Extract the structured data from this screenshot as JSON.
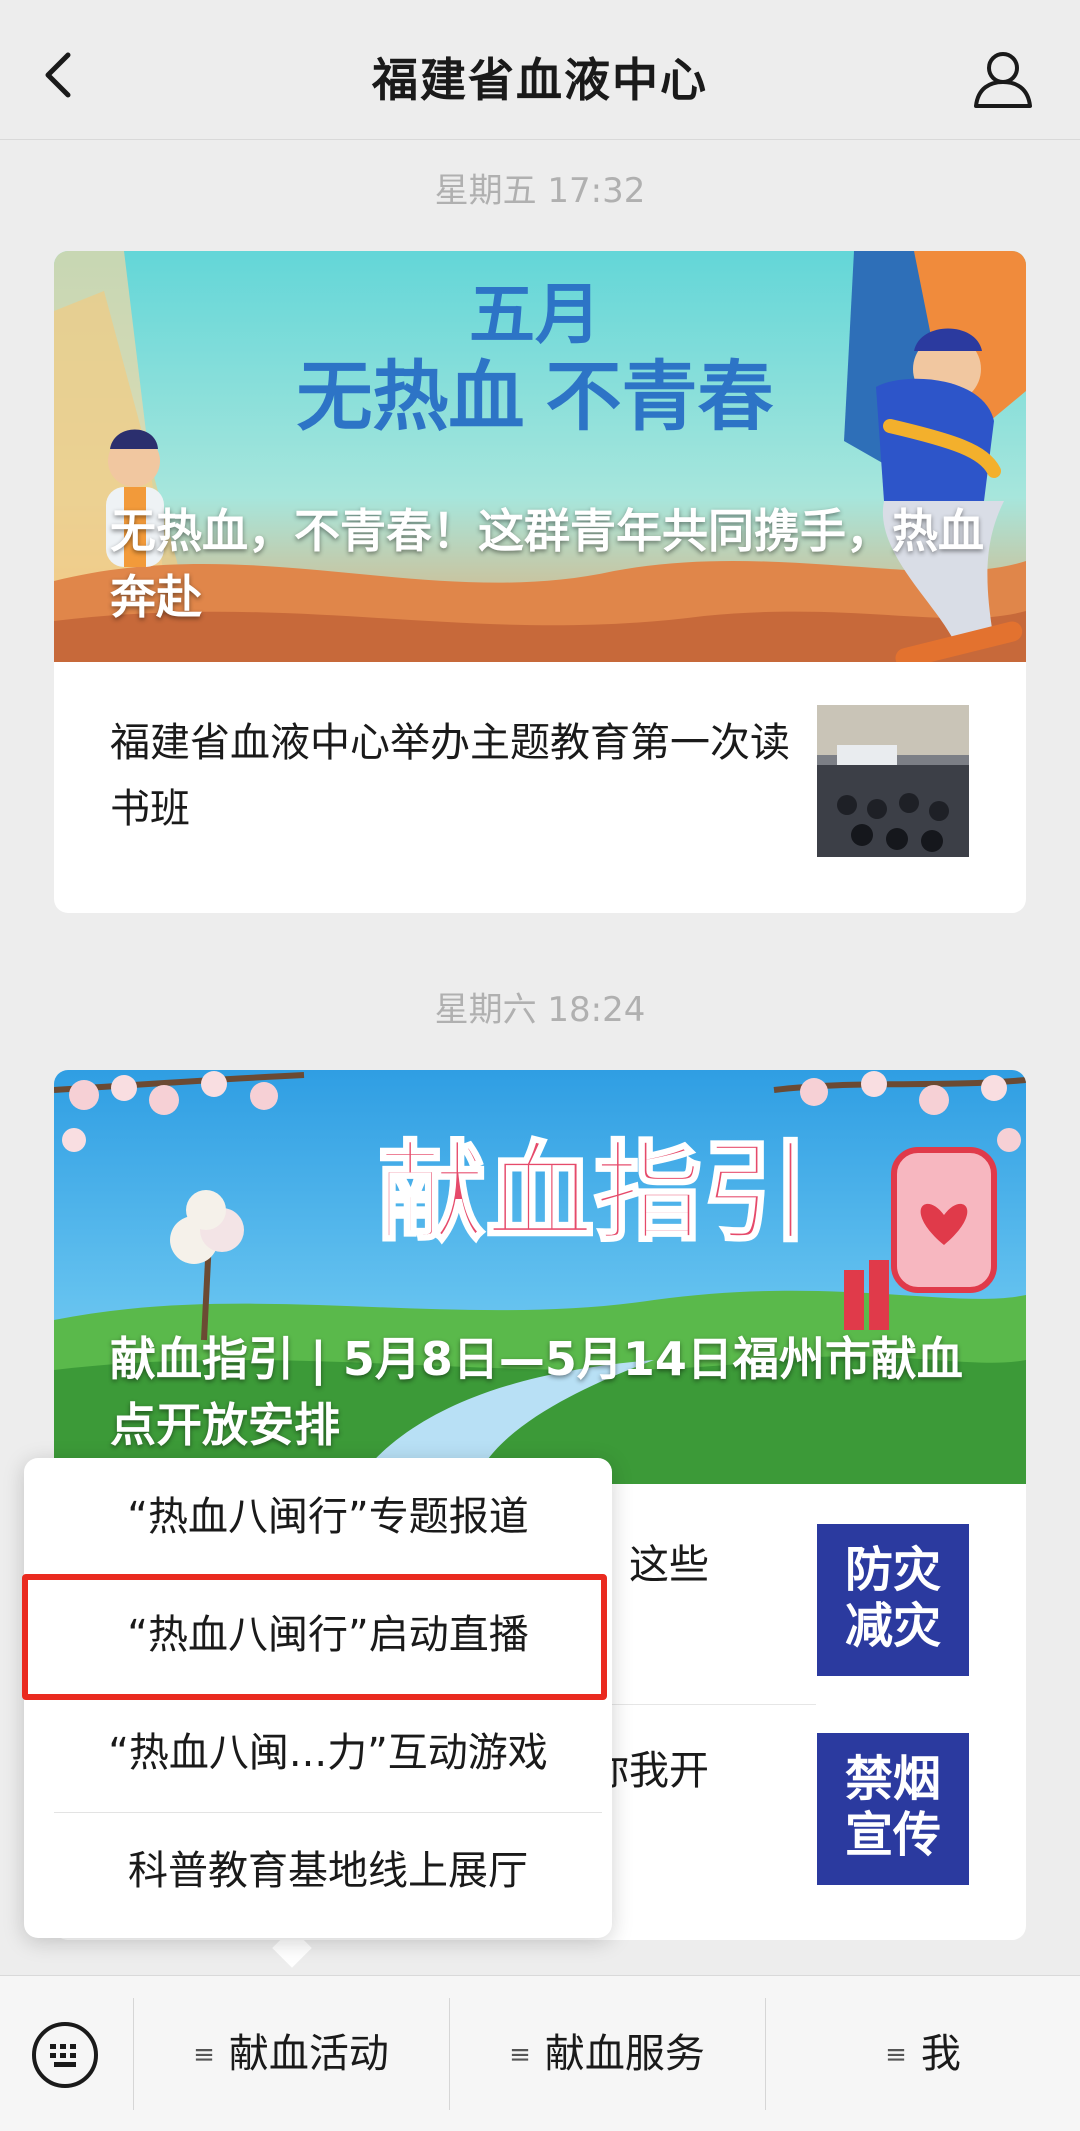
{
  "header": {
    "title": "福建省血液中心"
  },
  "timestamps": [
    "星期五 17:32",
    "星期六 18:24"
  ],
  "article1": {
    "banner_text_line1": "五月",
    "banner_text_line2": "无热血 不青春",
    "main_title": "无热血，不青春！这群青年共同携手，热血奔赴",
    "sub_title": "福建省血液中心举办主题教育第一次读书班"
  },
  "article2": {
    "banner_text": "献血指引",
    "main_title": "献血指引 | 5月8日—5月14日福州市献血点开放安排",
    "sub1_visible": "！这些",
    "sub1_thumb_text": "防灾减灾",
    "sub2_visible": "你我开",
    "sub2_thumb_text": "禁烟宣传"
  },
  "popup": {
    "items": [
      "“热血八闽行”专题报道",
      "“热血八闽行”启动直播",
      "“热血八闽...力”互动游戏",
      "科普教育基地线上展厅"
    ]
  },
  "bottom_bar": {
    "tabs": [
      "献血活动",
      "献血服务",
      "我"
    ],
    "menu_glyph": "≡"
  },
  "icons": [
    "back-arrow-icon",
    "profile-icon",
    "keyboard-icon",
    "menu-lines-icon"
  ],
  "colors": {
    "highlight": "#ea2a1f",
    "thumb_blue": "#2b3a9f"
  }
}
